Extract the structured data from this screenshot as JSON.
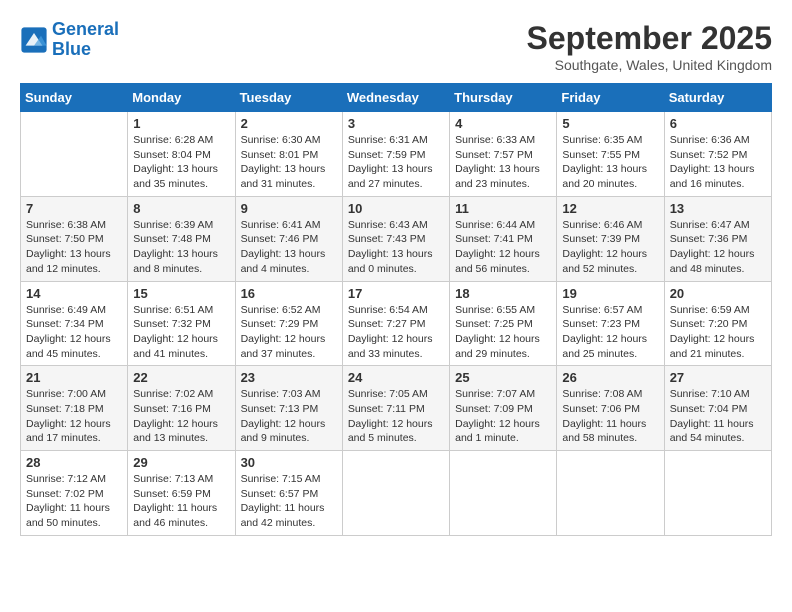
{
  "header": {
    "logo_line1": "General",
    "logo_line2": "Blue",
    "month": "September 2025",
    "location": "Southgate, Wales, United Kingdom"
  },
  "weekdays": [
    "Sunday",
    "Monday",
    "Tuesday",
    "Wednesday",
    "Thursday",
    "Friday",
    "Saturday"
  ],
  "weeks": [
    [
      {
        "day": "",
        "sunrise": "",
        "sunset": "",
        "daylight": ""
      },
      {
        "day": "1",
        "sunrise": "Sunrise: 6:28 AM",
        "sunset": "Sunset: 8:04 PM",
        "daylight": "Daylight: 13 hours and 35 minutes."
      },
      {
        "day": "2",
        "sunrise": "Sunrise: 6:30 AM",
        "sunset": "Sunset: 8:01 PM",
        "daylight": "Daylight: 13 hours and 31 minutes."
      },
      {
        "day": "3",
        "sunrise": "Sunrise: 6:31 AM",
        "sunset": "Sunset: 7:59 PM",
        "daylight": "Daylight: 13 hours and 27 minutes."
      },
      {
        "day": "4",
        "sunrise": "Sunrise: 6:33 AM",
        "sunset": "Sunset: 7:57 PM",
        "daylight": "Daylight: 13 hours and 23 minutes."
      },
      {
        "day": "5",
        "sunrise": "Sunrise: 6:35 AM",
        "sunset": "Sunset: 7:55 PM",
        "daylight": "Daylight: 13 hours and 20 minutes."
      },
      {
        "day": "6",
        "sunrise": "Sunrise: 6:36 AM",
        "sunset": "Sunset: 7:52 PM",
        "daylight": "Daylight: 13 hours and 16 minutes."
      }
    ],
    [
      {
        "day": "7",
        "sunrise": "Sunrise: 6:38 AM",
        "sunset": "Sunset: 7:50 PM",
        "daylight": "Daylight: 13 hours and 12 minutes."
      },
      {
        "day": "8",
        "sunrise": "Sunrise: 6:39 AM",
        "sunset": "Sunset: 7:48 PM",
        "daylight": "Daylight: 13 hours and 8 minutes."
      },
      {
        "day": "9",
        "sunrise": "Sunrise: 6:41 AM",
        "sunset": "Sunset: 7:46 PM",
        "daylight": "Daylight: 13 hours and 4 minutes."
      },
      {
        "day": "10",
        "sunrise": "Sunrise: 6:43 AM",
        "sunset": "Sunset: 7:43 PM",
        "daylight": "Daylight: 13 hours and 0 minutes."
      },
      {
        "day": "11",
        "sunrise": "Sunrise: 6:44 AM",
        "sunset": "Sunset: 7:41 PM",
        "daylight": "Daylight: 12 hours and 56 minutes."
      },
      {
        "day": "12",
        "sunrise": "Sunrise: 6:46 AM",
        "sunset": "Sunset: 7:39 PM",
        "daylight": "Daylight: 12 hours and 52 minutes."
      },
      {
        "day": "13",
        "sunrise": "Sunrise: 6:47 AM",
        "sunset": "Sunset: 7:36 PM",
        "daylight": "Daylight: 12 hours and 48 minutes."
      }
    ],
    [
      {
        "day": "14",
        "sunrise": "Sunrise: 6:49 AM",
        "sunset": "Sunset: 7:34 PM",
        "daylight": "Daylight: 12 hours and 45 minutes."
      },
      {
        "day": "15",
        "sunrise": "Sunrise: 6:51 AM",
        "sunset": "Sunset: 7:32 PM",
        "daylight": "Daylight: 12 hours and 41 minutes."
      },
      {
        "day": "16",
        "sunrise": "Sunrise: 6:52 AM",
        "sunset": "Sunset: 7:29 PM",
        "daylight": "Daylight: 12 hours and 37 minutes."
      },
      {
        "day": "17",
        "sunrise": "Sunrise: 6:54 AM",
        "sunset": "Sunset: 7:27 PM",
        "daylight": "Daylight: 12 hours and 33 minutes."
      },
      {
        "day": "18",
        "sunrise": "Sunrise: 6:55 AM",
        "sunset": "Sunset: 7:25 PM",
        "daylight": "Daylight: 12 hours and 29 minutes."
      },
      {
        "day": "19",
        "sunrise": "Sunrise: 6:57 AM",
        "sunset": "Sunset: 7:23 PM",
        "daylight": "Daylight: 12 hours and 25 minutes."
      },
      {
        "day": "20",
        "sunrise": "Sunrise: 6:59 AM",
        "sunset": "Sunset: 7:20 PM",
        "daylight": "Daylight: 12 hours and 21 minutes."
      }
    ],
    [
      {
        "day": "21",
        "sunrise": "Sunrise: 7:00 AM",
        "sunset": "Sunset: 7:18 PM",
        "daylight": "Daylight: 12 hours and 17 minutes."
      },
      {
        "day": "22",
        "sunrise": "Sunrise: 7:02 AM",
        "sunset": "Sunset: 7:16 PM",
        "daylight": "Daylight: 12 hours and 13 minutes."
      },
      {
        "day": "23",
        "sunrise": "Sunrise: 7:03 AM",
        "sunset": "Sunset: 7:13 PM",
        "daylight": "Daylight: 12 hours and 9 minutes."
      },
      {
        "day": "24",
        "sunrise": "Sunrise: 7:05 AM",
        "sunset": "Sunset: 7:11 PM",
        "daylight": "Daylight: 12 hours and 5 minutes."
      },
      {
        "day": "25",
        "sunrise": "Sunrise: 7:07 AM",
        "sunset": "Sunset: 7:09 PM",
        "daylight": "Daylight: 12 hours and 1 minute."
      },
      {
        "day": "26",
        "sunrise": "Sunrise: 7:08 AM",
        "sunset": "Sunset: 7:06 PM",
        "daylight": "Daylight: 11 hours and 58 minutes."
      },
      {
        "day": "27",
        "sunrise": "Sunrise: 7:10 AM",
        "sunset": "Sunset: 7:04 PM",
        "daylight": "Daylight: 11 hours and 54 minutes."
      }
    ],
    [
      {
        "day": "28",
        "sunrise": "Sunrise: 7:12 AM",
        "sunset": "Sunset: 7:02 PM",
        "daylight": "Daylight: 11 hours and 50 minutes."
      },
      {
        "day": "29",
        "sunrise": "Sunrise: 7:13 AM",
        "sunset": "Sunset: 6:59 PM",
        "daylight": "Daylight: 11 hours and 46 minutes."
      },
      {
        "day": "30",
        "sunrise": "Sunrise: 7:15 AM",
        "sunset": "Sunset: 6:57 PM",
        "daylight": "Daylight: 11 hours and 42 minutes."
      },
      {
        "day": "",
        "sunrise": "",
        "sunset": "",
        "daylight": ""
      },
      {
        "day": "",
        "sunrise": "",
        "sunset": "",
        "daylight": ""
      },
      {
        "day": "",
        "sunrise": "",
        "sunset": "",
        "daylight": ""
      },
      {
        "day": "",
        "sunrise": "",
        "sunset": "",
        "daylight": ""
      }
    ]
  ]
}
